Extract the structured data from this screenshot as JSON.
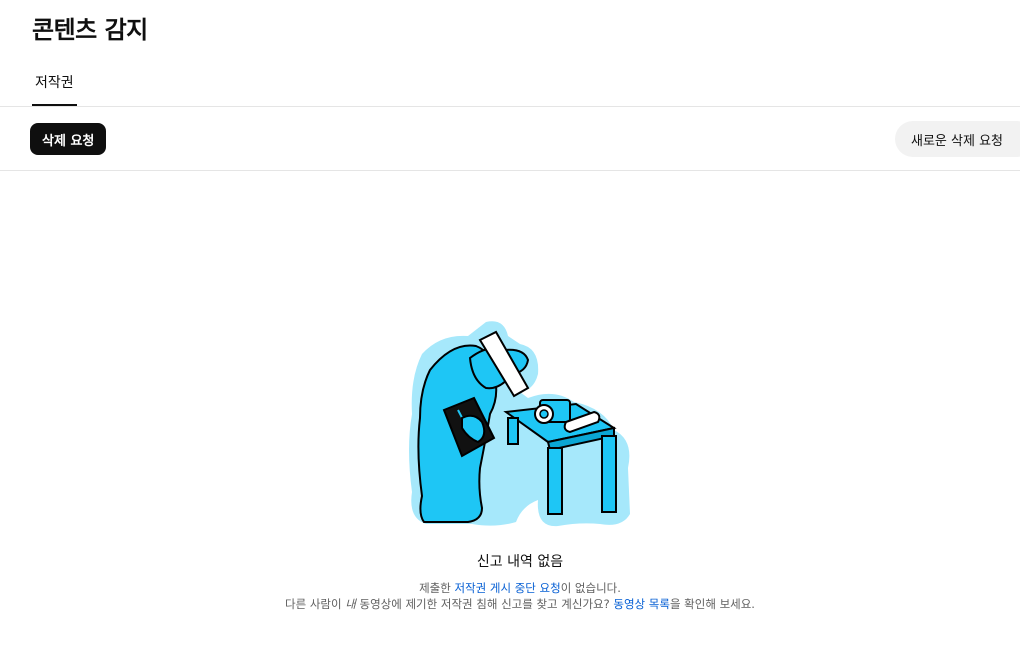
{
  "page": {
    "title": "콘텐츠 감지"
  },
  "tabs": [
    {
      "label": "저작권",
      "active": true
    }
  ],
  "toolbar": {
    "filter_chip_label": "삭제 요청",
    "new_request_button_label": "새로운 삭제 요청"
  },
  "empty_state": {
    "illustration_icon": "person-inspecting-camera-illustration",
    "title": "신고 내역 없음",
    "line1_prefix": "제출한 ",
    "line1_link": "저작권 게시 중단 요청",
    "line1_suffix": "이 없습니다.",
    "line2_prefix": "다른 사람이 ",
    "line2_emphasis": "내",
    "line2_middle": " 동영상에 제기한 저작권 침해 신고를 찾고 계신가요? ",
    "line2_link": "동영상 목록",
    "line2_suffix": "을 확인해 보세요."
  },
  "colors": {
    "accent_link": "#065fd4",
    "chip_active_bg": "#0f0f0f",
    "illustration_blue": "#1ec6f5",
    "illustration_halo": "#a6e8fb"
  }
}
